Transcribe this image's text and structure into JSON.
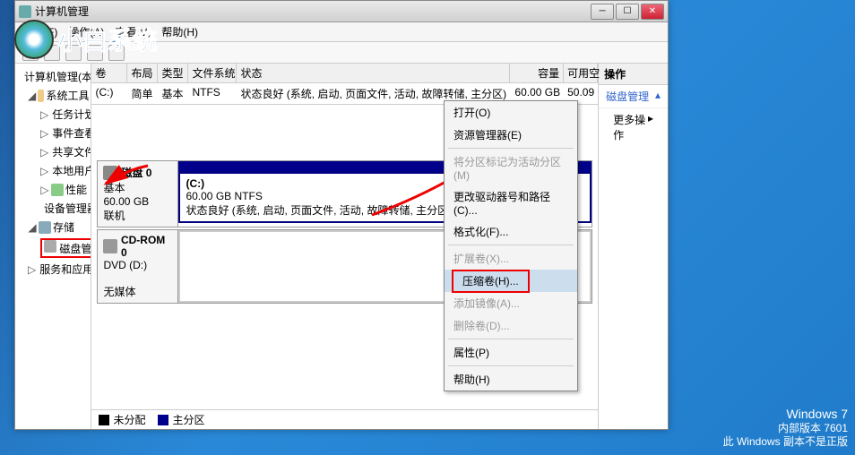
{
  "window": {
    "title": "计算机管理"
  },
  "menu": {
    "file": "文件(F)",
    "action": "操作(A)",
    "view": "查看(V)",
    "help": "帮助(H)"
  },
  "tree": {
    "root": "计算机管理(本地)",
    "sysTools": "系统工具",
    "taskSched": "任务计划程序",
    "eventViewer": "事件查看器",
    "sharedFolders": "共享文件夹",
    "localUsers": "本地用户和组",
    "perf": "性能",
    "devMgr": "设备管理器",
    "storage": "存储",
    "diskMgmt": "磁盘管理",
    "services": "服务和应用程序"
  },
  "volHead": {
    "vol": "卷",
    "layout": "布局",
    "type": "类型",
    "fs": "文件系统",
    "status": "状态",
    "cap": "容量",
    "free": "可用空"
  },
  "volRow": {
    "name": "(C:)",
    "layout": "简单",
    "type": "基本",
    "fs": "NTFS",
    "status": "状态良好 (系统, 启动, 页面文件, 活动, 故障转储, 主分区)",
    "cap": "60.00 GB",
    "free": "50.09"
  },
  "disk0": {
    "title": "磁盘 0",
    "kind": "基本",
    "size": "60.00 GB",
    "state": "联机",
    "partName": "(C:)",
    "partSize": "60.00 GB NTFS",
    "partStatus": "状态良好 (系统, 启动, 页面文件, 活动, 故障转储, 主分区)"
  },
  "cdrom": {
    "title": "CD-ROM 0",
    "drive": "DVD (D:)",
    "state": "无媒体"
  },
  "legend": {
    "unalloc": "未分配",
    "primary": "主分区"
  },
  "actions": {
    "head": "操作",
    "disk": "磁盘管理",
    "more": "更多操作"
  },
  "context": {
    "open": "打开(O)",
    "explorer": "资源管理器(E)",
    "markActive": "将分区标记为活动分区(M)",
    "changeLetter": "更改驱动器号和路径(C)...",
    "format": "格式化(F)...",
    "extend": "扩展卷(X)...",
    "shrink": "压缩卷(H)...",
    "mirror": "添加镜像(A)...",
    "delete": "删除卷(D)...",
    "props": "属性(P)",
    "help": "帮助(H)"
  },
  "watermark": {
    "l1": "Windows 7",
    "l2": "内部版本 7601",
    "l3": "此 Windows 副本不是正版"
  },
  "logoText": "小白系统"
}
